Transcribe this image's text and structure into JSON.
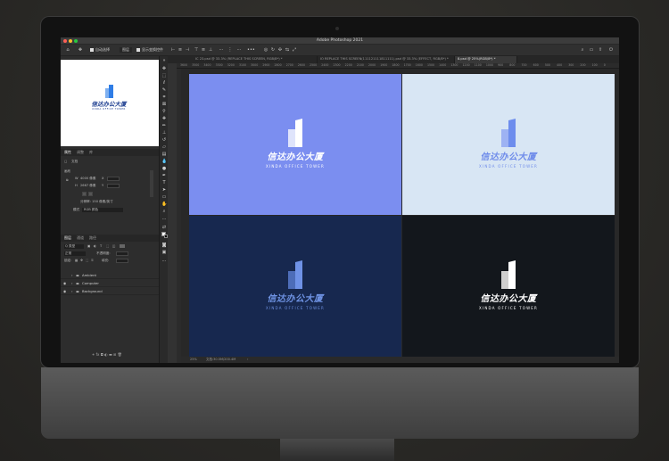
{
  "window": {
    "title": "Adobe Photoshop 2021"
  },
  "options_bar": {
    "auto_select_label": "自动选择",
    "group_value": "图层",
    "show_transform_label": "显示变换控件"
  },
  "document_tabs": [
    {
      "label": "IC 23.psd @ 33.3% (REPLACE THIS SCREEN, RGB/8*) *",
      "active": false
    },
    {
      "label": "IO REPLACE THIS SCREEN(111121111811111).psd @ 33.3% (EFFECT, RGB/8*) *",
      "active": false
    },
    {
      "label": "8.psd @ 25%(RGB/8*) *",
      "active": true
    }
  ],
  "ruler_ticks": [
    "3600",
    "3500",
    "3400",
    "3300",
    "3200",
    "3100",
    "3000",
    "2900",
    "2800",
    "2700",
    "2600",
    "2500",
    "2400",
    "2300",
    "2200",
    "2100",
    "2000",
    "1900",
    "1800",
    "1700",
    "1600",
    "1500",
    "1400",
    "1300",
    "1200",
    "1100",
    "1000",
    "900",
    "800",
    "700",
    "600",
    "500",
    "400",
    "300",
    "200",
    "100",
    "0"
  ],
  "left_panel": {
    "panel_tabs": [
      {
        "label": "属性",
        "active": true
      },
      {
        "label": "调整",
        "active": false
      },
      {
        "label": "库",
        "active": false
      }
    ],
    "document_label": "文档",
    "canvas_section": "画布",
    "width_label": "W",
    "width_value": "4000 像素",
    "height_label": "H",
    "height_value": "2667 像素",
    "x_label": "X",
    "y_label": "Y",
    "resolution_text": "分辨率: 150 像素/英寸",
    "mode_label": "模式",
    "mode_value": "RGB 颜色",
    "layers_tabs": [
      {
        "label": "图层",
        "active": true
      },
      {
        "label": "通道",
        "active": false
      },
      {
        "label": "路径",
        "active": false
      }
    ],
    "kind_label": "Q 类型",
    "blend_value": "正常",
    "opacity_label": "不透明度:",
    "lock_label": "锁定:",
    "fill_label": "填充:",
    "layers": [
      {
        "name": "Ambient",
        "visible": false
      },
      {
        "name": "Computer",
        "visible": true
      },
      {
        "name": "Background",
        "visible": true
      }
    ]
  },
  "status": {
    "zoom": "25%",
    "doc_info": "文档:30.5M/200.4M"
  },
  "artboards": [
    {
      "bg": "#7b8ef0",
      "text_color": "#ffffff",
      "brand": "信达办公大厦",
      "subtitle": "XINDA OFFICE TOWER",
      "mark_color": "#ffffff",
      "mark_shade": "#dfe4fb"
    },
    {
      "bg": "#d8e6f4",
      "text_color": "#6f8cea",
      "brand": "信达办公大厦",
      "subtitle": "XINDA OFFICE TOWER",
      "mark_color": "#6d8ded",
      "mark_shade": "#9db2f3"
    },
    {
      "bg": "#17284f",
      "text_color": "#6f93e4",
      "brand": "信达办公大厦",
      "subtitle": "XINDA OFFICE TOWER",
      "mark_color": "#6f92e6",
      "mark_shade": "#4d6db8"
    },
    {
      "bg": "#13171c",
      "text_color": "#ffffff",
      "brand": "信达办公大厦",
      "subtitle": "XINDA OFFICE TOWER",
      "mark_color": "#ffffff",
      "mark_shade": "#cfcfcf"
    }
  ],
  "thumbnail": {
    "brand": "信达办公大厦",
    "subtitle": "XINDA OFFICE TOWER",
    "brand_color": "#1a3b8f",
    "mark_color": "#2f7de6"
  }
}
